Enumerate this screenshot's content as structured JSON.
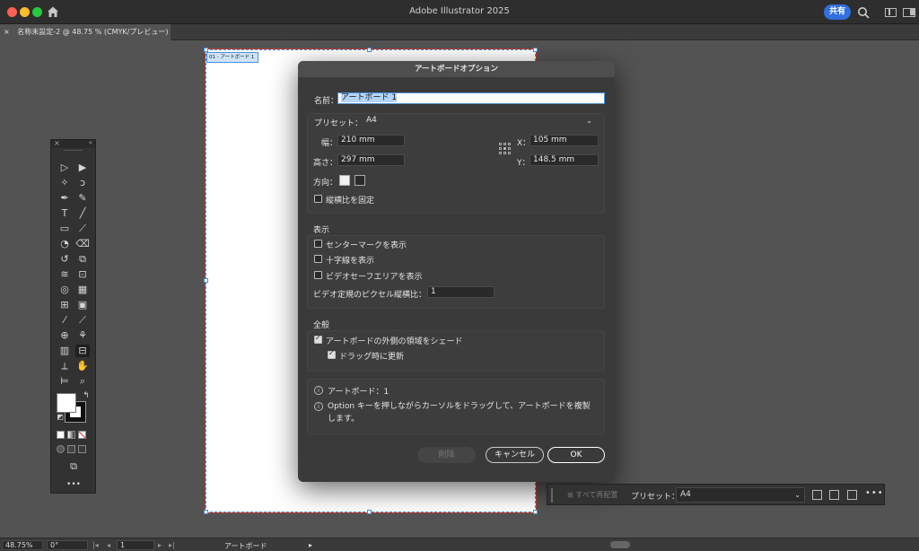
{
  "window": {
    "app_title": "Adobe Illustrator 2025",
    "share_label": "共有"
  },
  "document_tab": {
    "close": "×",
    "title": "名称未設定-2 @ 48.75 % (CMYK/プレビュー)"
  },
  "artboard": {
    "label": "01 - アートボード 1"
  },
  "toolbar": {
    "more": "•••"
  },
  "dialog": {
    "title": "アートボードオプション",
    "name_label": "名前：",
    "name_value": "アートボード 1",
    "preset_label": "プリセット：",
    "preset_value": "A4",
    "width_label": "幅：",
    "width_value": "210 mm",
    "height_label": "高さ：",
    "height_value": "297 mm",
    "x_label": "X：",
    "x_value": "105 mm",
    "y_label": "Y：",
    "y_value": "148.5 mm",
    "orientation_label": "方向：",
    "lock_ratio_label": "縦横比を固定",
    "lock_ratio_checked": false,
    "display_section": "表示",
    "center_mark_label": "センターマークを表示",
    "center_mark_checked": false,
    "cross_hairs_label": "十字線を表示",
    "cross_hairs_checked": false,
    "video_safe_label": "ビデオセーフエリアを表示",
    "video_safe_checked": false,
    "pixel_ratio_label": "ビデオ定規のピクセル縦横比：",
    "pixel_ratio_value": "1",
    "global_section": "全般",
    "fade_outside_label": "アートボードの外側の領域をシェード",
    "fade_outside_checked": true,
    "update_drag_label": "ドラッグ時に更新",
    "update_drag_checked": true,
    "info_artboards": "アートボード：1",
    "info_option_tip": "Option キーを押しながらカーソルをドラッグして、アートボードを複製します。",
    "delete_label": "削除",
    "cancel_label": "キャンセル",
    "ok_label": "OK"
  },
  "artboard_bar": {
    "rearrange_label": "すべて再配置",
    "preset_label": "プリセット：",
    "preset_value": "A4",
    "more": "•••"
  },
  "status_bar": {
    "zoom": "48.75%",
    "rotation": "0°",
    "artboard_index": "1",
    "tool_name": "アートボード"
  },
  "colors": {
    "accent": "#2f6fe0",
    "selection": "#4a90d9",
    "artboard_border": "#c0392b"
  }
}
